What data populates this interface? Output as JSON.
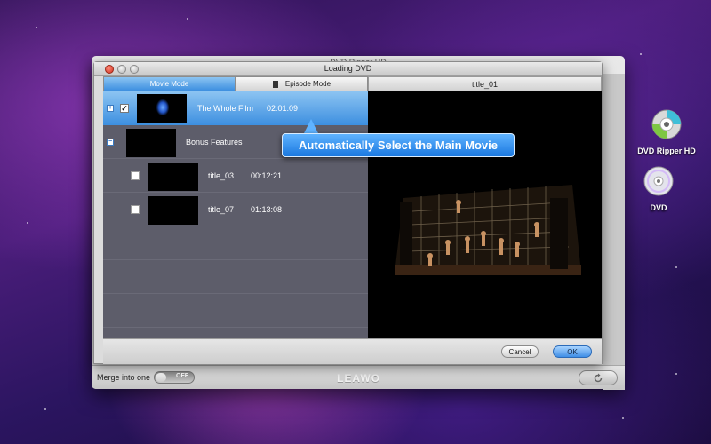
{
  "desktop": {
    "icons": [
      {
        "label": "DVD Ripper HD"
      },
      {
        "label": "DVD"
      }
    ]
  },
  "app_window": {
    "title": "DVD Ripper HD",
    "merge_label": "Merge into one",
    "merge_toggle": "OFF",
    "brand": "LEAWO"
  },
  "dialog": {
    "title": "Loading DVD",
    "tabs": [
      {
        "label": "Movie Mode",
        "active": true
      },
      {
        "label": "Episode Mode",
        "active": false
      }
    ],
    "preview_title": "title_01",
    "items": [
      {
        "expander": "+",
        "checked": true,
        "name": "The Whole Film",
        "duration": "02:01:09",
        "selected": true
      },
      {
        "expander": "−",
        "checked": false,
        "name": "Bonus Features",
        "duration": "",
        "selected": false
      },
      {
        "expander": "",
        "checked": false,
        "name": "title_03",
        "duration": "00:12:21",
        "selected": false
      },
      {
        "expander": "",
        "checked": false,
        "name": "title_07",
        "duration": "01:13:08",
        "selected": false
      }
    ],
    "cancel_label": "Cancel",
    "ok_label": "OK"
  },
  "callout": {
    "text": "Automatically Select the Main Movie"
  },
  "colors": {
    "selection_blue": "#3d8fe0",
    "list_bg": "#5d5d6a",
    "callout_blue": "#1a78e0"
  }
}
